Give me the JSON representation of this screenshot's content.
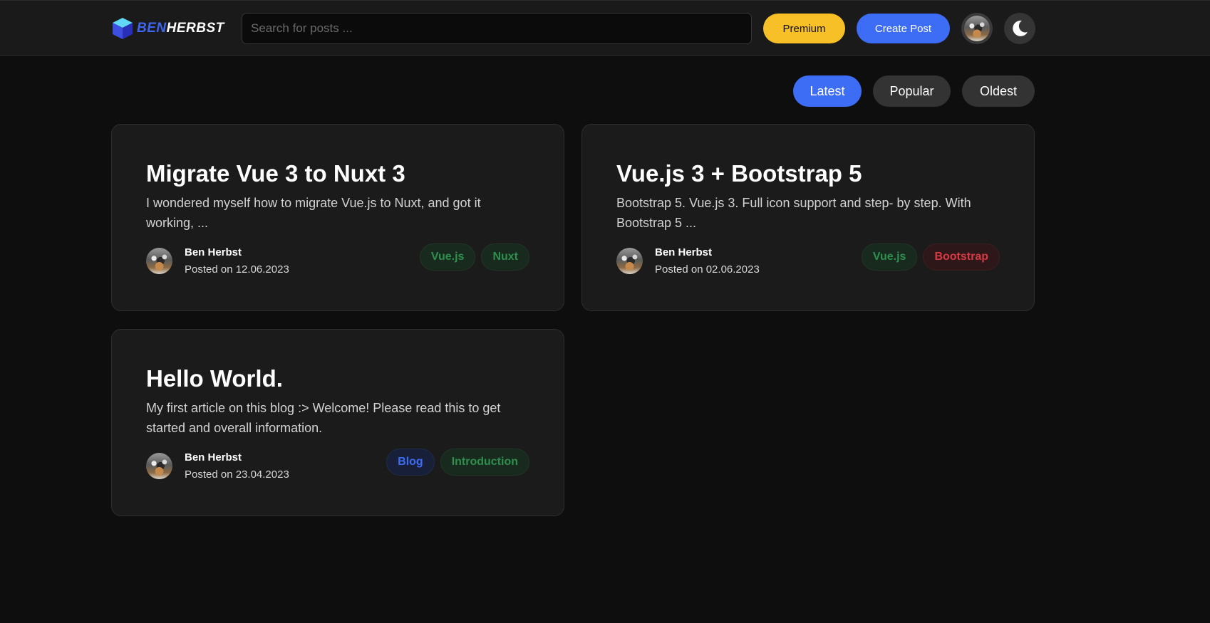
{
  "nav": {
    "logo_part1": "BEN",
    "logo_part2": "HERBST",
    "search_placeholder": "Search for posts ...",
    "premium_label": "Premium",
    "create_label": "Create Post",
    "logo_icon": "cube-icon",
    "theme_icon": "moon-icon"
  },
  "sort": {
    "latest": "Latest",
    "popular": "Popular",
    "oldest": "Oldest",
    "active": "Latest"
  },
  "posts": [
    {
      "title": "Migrate Vue 3 to Nuxt 3",
      "excerpt": "I wondered myself how to migrate Vue.js to Nuxt, and got it working, ...",
      "author": "Ben Herbst",
      "date": "Posted on 12.06.2023",
      "tags": [
        {
          "label": "Vue.js",
          "color": "green"
        },
        {
          "label": "Nuxt",
          "color": "green"
        }
      ]
    },
    {
      "title": "Vue.js 3 + Bootstrap 5",
      "excerpt": "Bootstrap 5. Vue.js 3. Full icon support and step- by step. With Bootstrap 5 ...",
      "author": "Ben Herbst",
      "date": "Posted on 02.06.2023",
      "tags": [
        {
          "label": "Vue.js",
          "color": "green"
        },
        {
          "label": "Bootstrap",
          "color": "red"
        }
      ]
    },
    {
      "title": "Hello World.",
      "excerpt": "My first article on this blog :> Welcome! Please read this to get started and overall information.",
      "author": "Ben Herbst",
      "date": "Posted on 23.04.2023",
      "tags": [
        {
          "label": "Blog",
          "color": "blue"
        },
        {
          "label": "Introduction",
          "color": "green"
        }
      ]
    }
  ],
  "colors": {
    "accent": "#3e6df5",
    "premium": "#f6c026",
    "background": "#0e0e0e",
    "card": "#1b1b1b"
  }
}
